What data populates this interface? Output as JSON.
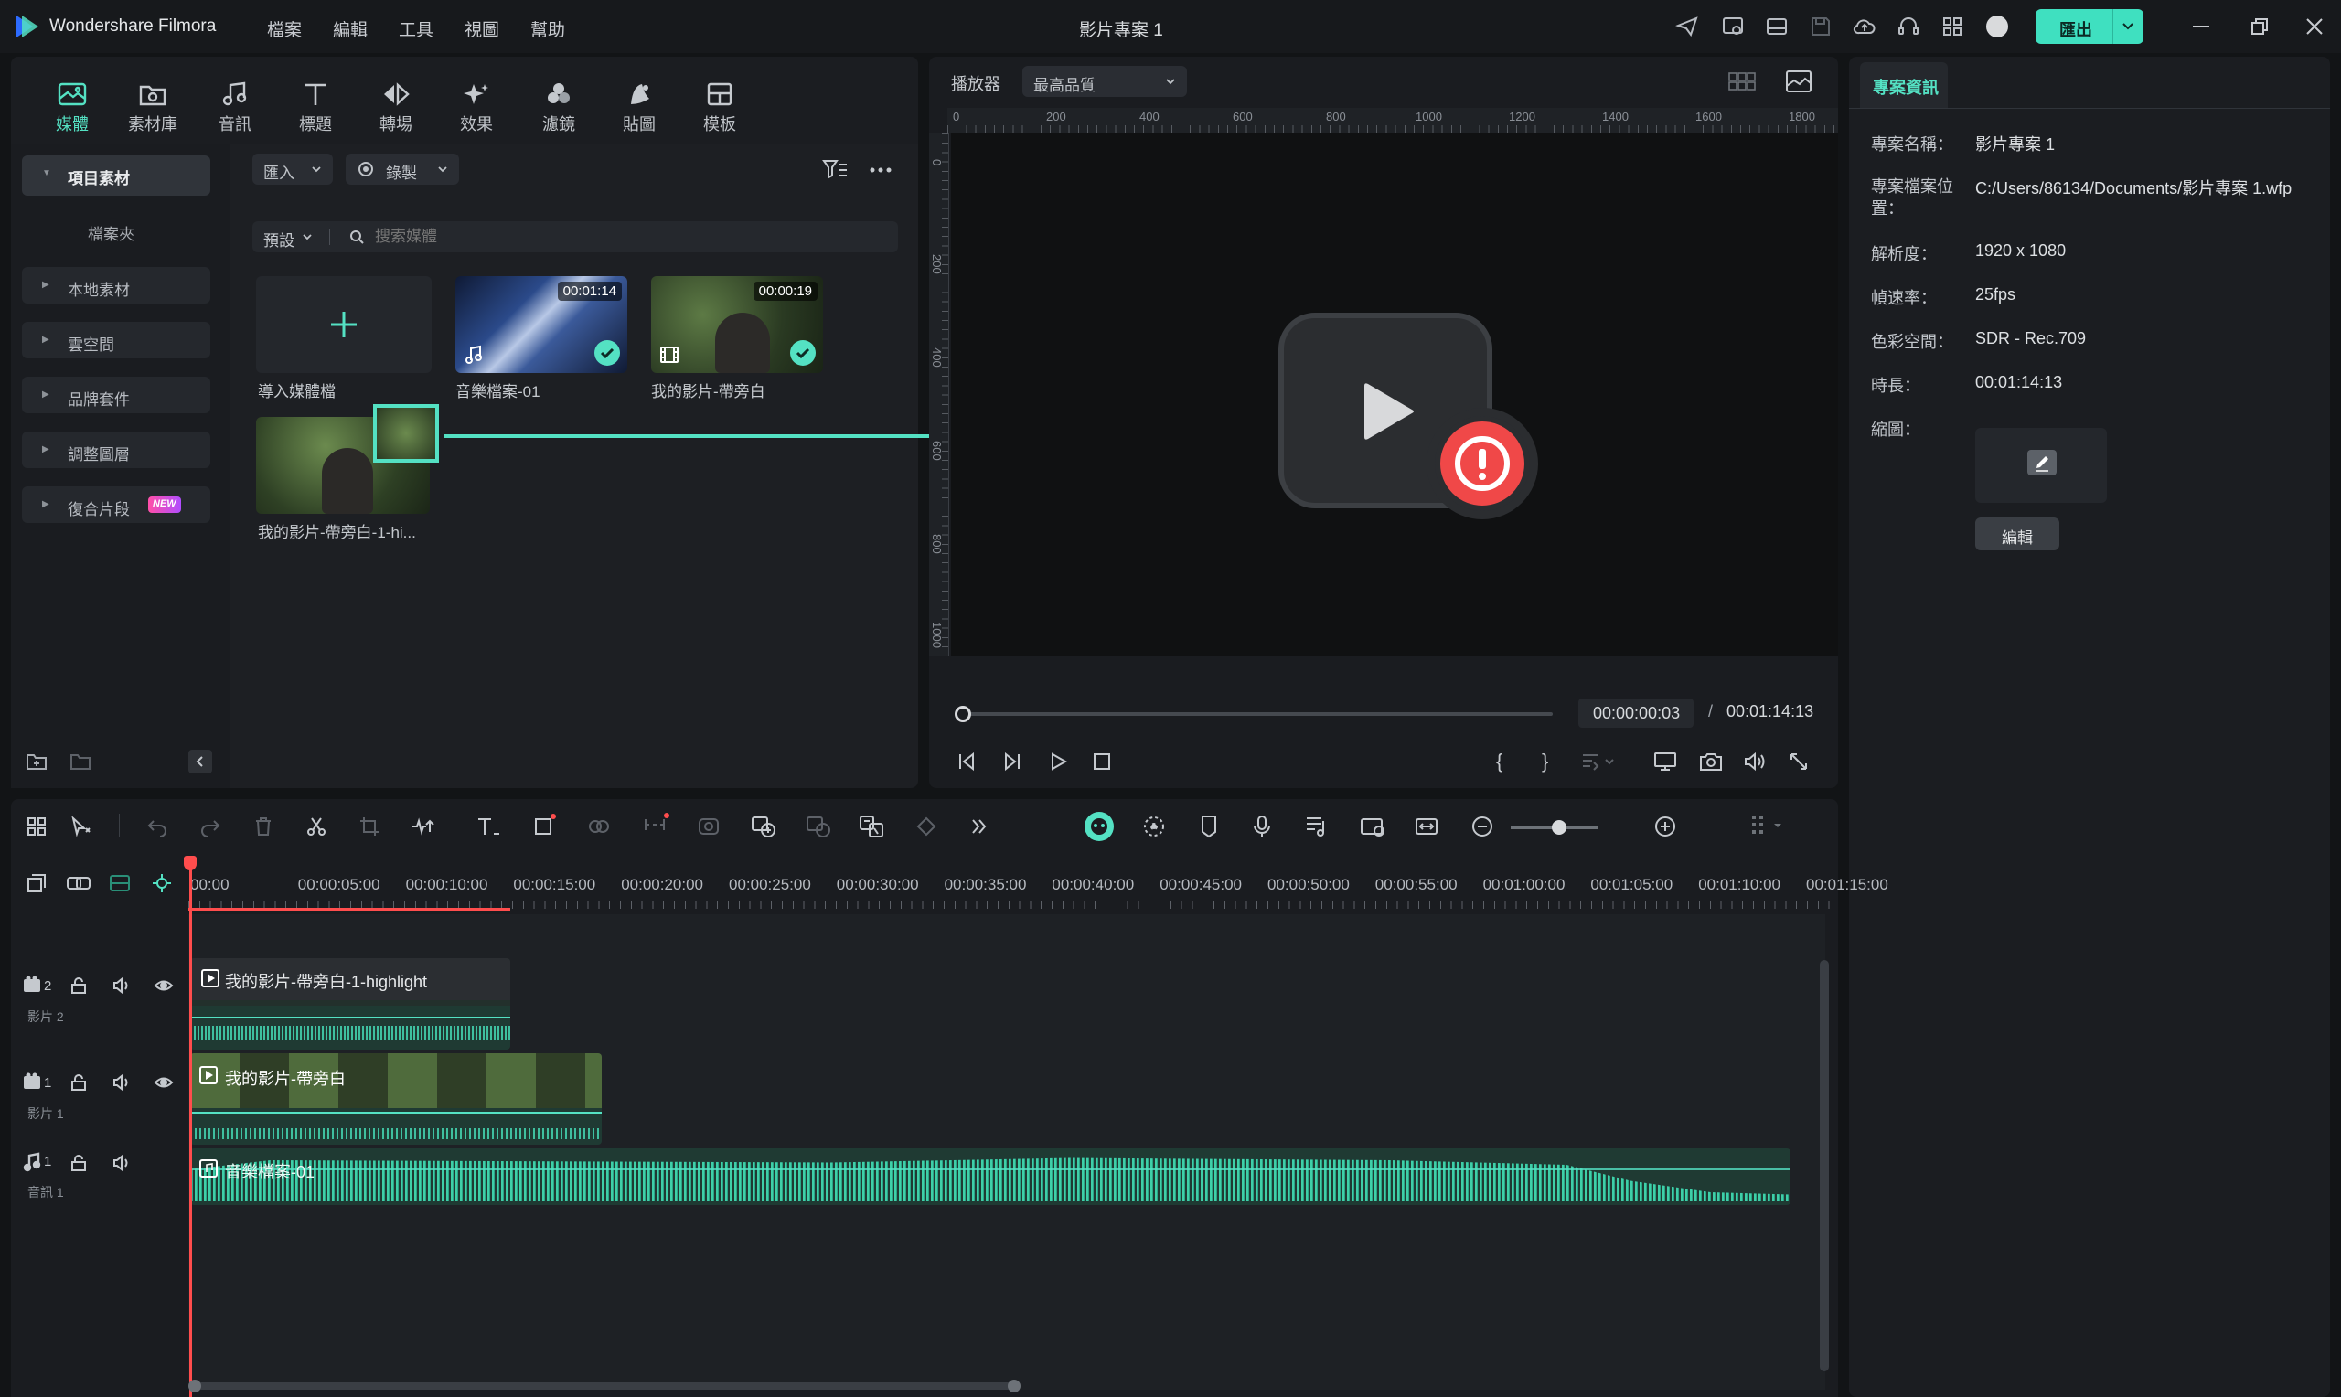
{
  "app": {
    "title": "Wondershare Filmora",
    "project_title": "影片專案 1",
    "export_label": "匯出"
  },
  "menus": [
    "檔案",
    "編輯",
    "工具",
    "視圖",
    "幫助"
  ],
  "toolbar": [
    {
      "label": "媒體",
      "icon": "media-icon",
      "active": true
    },
    {
      "label": "素材庫",
      "icon": "stock-icon"
    },
    {
      "label": "音訊",
      "icon": "music-icon"
    },
    {
      "label": "標題",
      "icon": "text-icon"
    },
    {
      "label": "轉場",
      "icon": "transition-icon"
    },
    {
      "label": "效果",
      "icon": "effects-icon"
    },
    {
      "label": "濾鏡",
      "icon": "filter-icon"
    },
    {
      "label": "貼圖",
      "icon": "sticker-icon"
    },
    {
      "label": "模板",
      "icon": "template-icon"
    }
  ],
  "sidebar": {
    "items": [
      "項目素材",
      "檔案夾",
      "本地素材",
      "雲空間",
      "品牌套件",
      "調整圖層",
      "復合片段"
    ],
    "new_badge": "NEW"
  },
  "media": {
    "import_label": "匯入",
    "record_label": "錄製",
    "sort_label": "預設",
    "search_placeholder": "搜索媒體",
    "items": [
      {
        "caption": "導入媒體檔"
      },
      {
        "caption": "音樂檔案-01",
        "duration": "00:01:14"
      },
      {
        "caption": "我的影片-帶旁白",
        "duration": "00:00:19"
      },
      {
        "caption": "我的影片-帶旁白-1-hi..."
      }
    ]
  },
  "player": {
    "label": "播放器",
    "quality": "最高品質",
    "current_time": "00:00:00:03",
    "separator": "/",
    "total_time": "00:01:14:13",
    "ruler_top": [
      "0",
      "200",
      "400",
      "600",
      "800",
      "1000",
      "1200",
      "1400",
      "1600",
      "1800"
    ],
    "ruler_left": [
      "0",
      "200",
      "400",
      "600",
      "800",
      "1000"
    ],
    "progress": 0.0
  },
  "project_info": {
    "tab": "專案資訊",
    "rows": [
      {
        "label": "專案名稱：",
        "value": "影片專案 1"
      },
      {
        "label": "專案檔案位置：",
        "value": "C:/Users/86134/Documents/影片專案 1.wfp"
      },
      {
        "label": "解析度：",
        "value": "1920 x 1080"
      },
      {
        "label": "幀速率：",
        "value": "25fps"
      },
      {
        "label": "色彩空間：",
        "value": "SDR - Rec.709"
      },
      {
        "label": "時長：",
        "value": "00:01:14:13"
      },
      {
        "label": "縮圖：",
        "value": ""
      }
    ],
    "edit_label": "編輯"
  },
  "timeline": {
    "ticks": [
      "00:00",
      "00:00:05:00",
      "00:00:10:00",
      "00:00:15:00",
      "00:00:20:00",
      "00:00:25:00",
      "00:00:30:00",
      "00:00:35:00",
      "00:00:40:00",
      "00:00:45:00",
      "00:00:50:00",
      "00:00:55:00",
      "00:01:00:00",
      "00:01:05:00",
      "00:01:10:00",
      "00:01:15:00"
    ],
    "tracks": [
      {
        "num": "2",
        "name": "影片 2",
        "clip": "我的影片-帶旁白-1-highlight"
      },
      {
        "num": "1",
        "name": "影片 1",
        "clip": "我的影片-帶旁白"
      },
      {
        "num": "1",
        "name": "音訊 1",
        "clip": "音樂檔案-01"
      }
    ],
    "zoom": 0.55
  },
  "colors": {
    "accent": "#54e1c3",
    "playhead": "#ff4d4d",
    "error": "#f04848"
  }
}
